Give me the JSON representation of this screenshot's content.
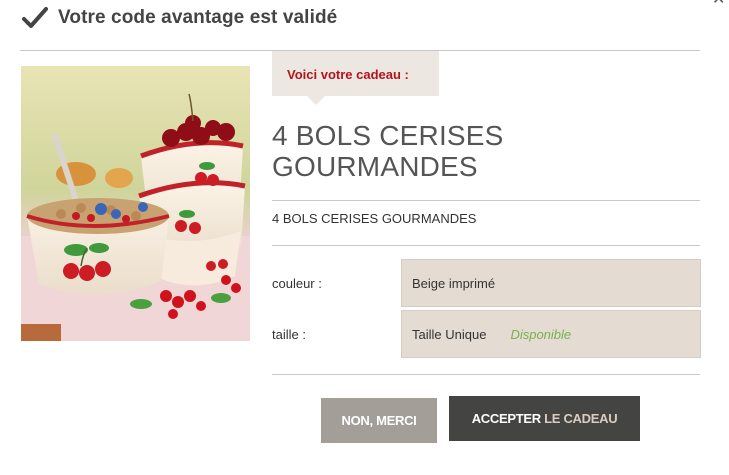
{
  "header": {
    "title": "Votre code avantage est validé"
  },
  "gift_tab": {
    "label": "Voici votre cadeau :"
  },
  "product": {
    "title_line1": "4 BOLS CERISES",
    "title_line2": "GOURMANDES",
    "subtitle": "4 BOLS CERISES GOURMANDES",
    "image": "cherry-bowls-photo"
  },
  "options": [
    {
      "label": "couleur :",
      "value": "Beige imprimé",
      "status": ""
    },
    {
      "label": "taille :",
      "value": "Taille Unique",
      "status": "Disponible"
    }
  ],
  "buttons": {
    "decline": "NON, MERCI",
    "accept_part1": "ACCEPTER",
    "accept_part2": "LE CADEAU"
  },
  "colors": {
    "gift_label": "#b4141e",
    "available": "#78b14d",
    "accept_bg": "#444442",
    "decline_bg": "#a39e98",
    "option_bg": "#e4dbd2"
  }
}
